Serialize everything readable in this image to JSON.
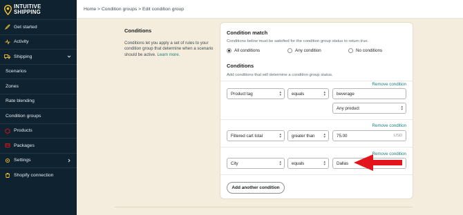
{
  "brand": {
    "name_line1": "INTUITIVE",
    "name_line2": "SHIPPING"
  },
  "sidebar": {
    "items": [
      {
        "label": "Get started",
        "icon": "rocket-icon"
      },
      {
        "label": "Activity",
        "icon": "activity-icon"
      },
      {
        "label": "Shipping",
        "icon": "truck-icon",
        "expanded": true
      },
      {
        "label": "Scenarios"
      },
      {
        "label": "Zones"
      },
      {
        "label": "Rate blending"
      },
      {
        "label": "Condition groups"
      },
      {
        "label": "Products",
        "icon": "products-icon"
      },
      {
        "label": "Packages",
        "icon": "package-icon"
      },
      {
        "label": "Settings",
        "icon": "settings-icon"
      },
      {
        "label": "Shopify connection",
        "icon": "shopify-icon"
      }
    ]
  },
  "breadcrumb": "Home > Condition groups > Edit condition group",
  "intro": {
    "title": "Conditions",
    "text": "Conditions let you apply a set of rules to your condition group that determine when a scenario should be active.",
    "link": "Learn more."
  },
  "condition_match": {
    "title": "Condition match",
    "description": "Conditions below must be satisfied for the condition group status to return true.",
    "options": [
      "All conditions",
      "Any condition",
      "No conditions"
    ],
    "selected": "All conditions"
  },
  "conditions": {
    "title": "Conditions",
    "description": "Add conditions that will determine a condition group status.",
    "remove_label": "Remove condition",
    "rows": [
      {
        "field": "Product tag",
        "operator": "equals",
        "value": "beverage",
        "scope": "Any product"
      },
      {
        "field": "Filtered cart total",
        "operator": "greater than",
        "value": "75.00",
        "unit": "USD"
      },
      {
        "field": "City",
        "operator": "equals",
        "value": "Dallas"
      }
    ],
    "add_label": "Add another condition"
  },
  "colors": {
    "sidebar_bg": "#0e2230",
    "page_bg": "#f4ecdc",
    "link": "#1a7e78",
    "accent_yellow": "#f2c230",
    "arrow_red": "#e3141b"
  }
}
